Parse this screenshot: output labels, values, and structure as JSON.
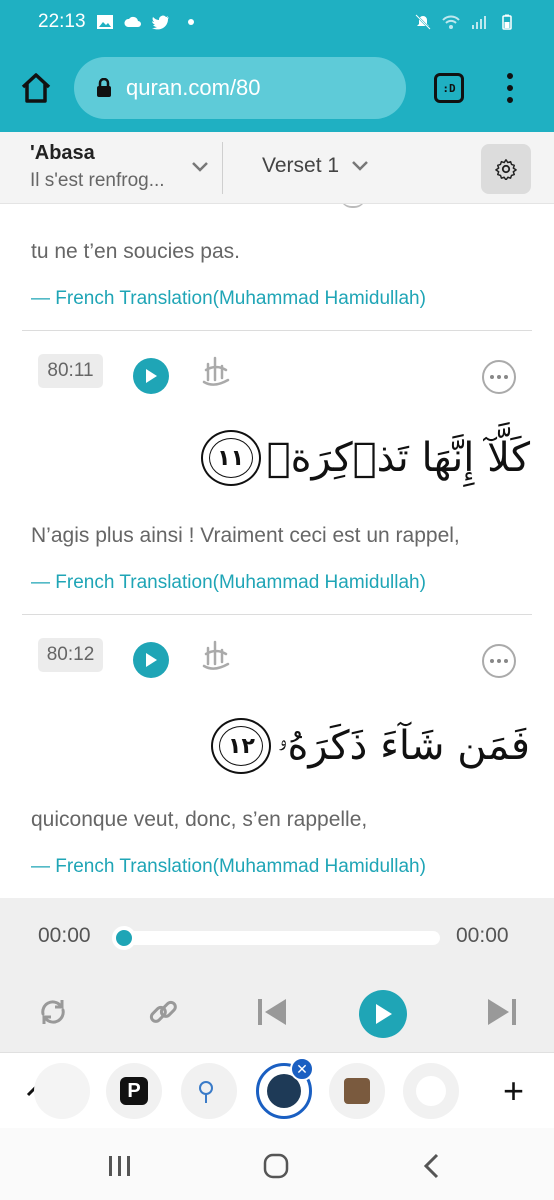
{
  "status": {
    "time": "22:13"
  },
  "browser": {
    "url": "quran.com/80",
    "tabs_label": ":D"
  },
  "chapter": {
    "name": "'Abasa",
    "subtitle": "Il s'est renfrog...",
    "verse_select": "Verset 1"
  },
  "verses": [
    {
      "translation": "tu ne t’en soucies pas.",
      "source": "— French Translation(Muhammad Hamidullah)"
    },
    {
      "key": "80:11",
      "arabic": "كَلَّآ إِنَّهَا تَذۡكِرَةٞ",
      "ayah_number": "١١",
      "translation": "N’agis plus ainsi ! Vraiment ceci est un rappel,",
      "source": "— French Translation(Muhammad Hamidullah)"
    },
    {
      "key": "80:12",
      "arabic": "فَمَن شَآءَ ذَكَرَهُۥ",
      "ayah_number": "١٢",
      "translation": "quiconque veut, donc, s’en rappelle,",
      "source": "— French Translation(Muhammad Hamidullah)"
    }
  ],
  "player": {
    "current_time": "00:00",
    "duration": "00:00",
    "progress": 0
  },
  "tabstrip": {
    "add_label": "+"
  },
  "colors": {
    "brand": "#1fb0c2",
    "accent": "#1fa5b6"
  }
}
